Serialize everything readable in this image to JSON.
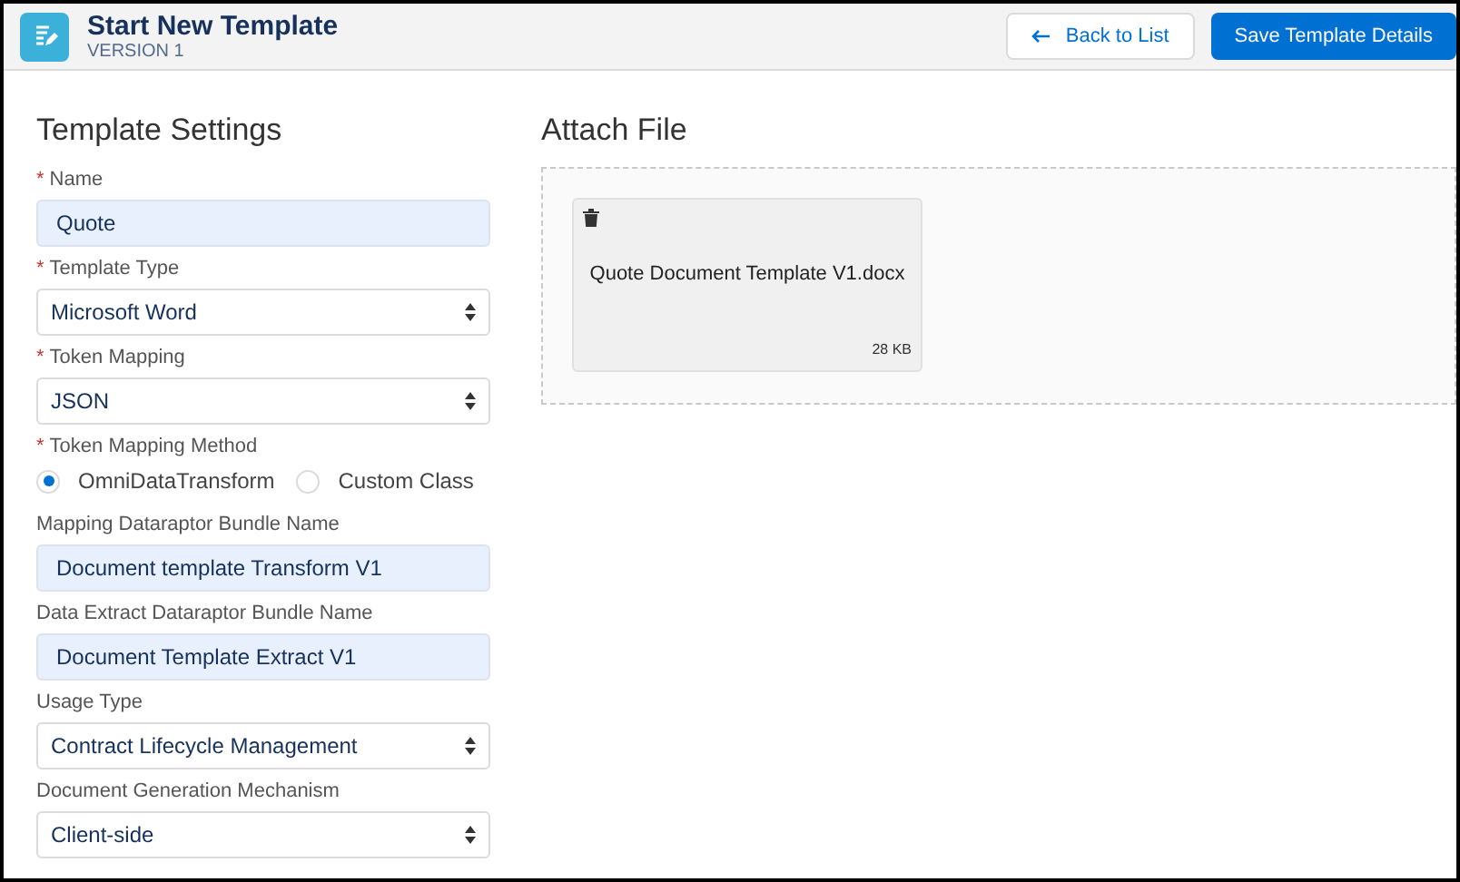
{
  "header": {
    "title": "Start New Template",
    "subtitle": "VERSION 1",
    "buttons": [
      {
        "label": "Back to List",
        "kind": "neutral"
      },
      {
        "label": "Save Template Details",
        "kind": "brand"
      }
    ]
  },
  "settings": {
    "title": "Template Settings",
    "fields": [
      {
        "kind": "input",
        "marker": "*",
        "label": "Name",
        "value": "Quote"
      },
      {
        "kind": "select",
        "marker": "*",
        "label": "Template Type",
        "value": "Microsoft Word"
      },
      {
        "kind": "select",
        "marker": "*",
        "label": "Token Mapping",
        "value": "JSON"
      },
      {
        "kind": "radio",
        "marker": "*",
        "label": "Token Mapping Method",
        "options": [
          {
            "label": "OmniDataTransform",
            "selected": true
          },
          {
            "label": "Custom Class",
            "selected": false
          }
        ]
      },
      {
        "kind": "input",
        "label": "Mapping Dataraptor Bundle Name",
        "value": "Document template Transform V1"
      },
      {
        "kind": "input",
        "label": "Data Extract Dataraptor Bundle Name",
        "value": "Document Template Extract V1"
      },
      {
        "kind": "select",
        "label": "Usage Type",
        "value": "Contract Lifecycle Management"
      },
      {
        "kind": "select",
        "label": "Document Generation Mechanism",
        "value": "Client-side"
      }
    ]
  },
  "attach": {
    "title": "Attach File",
    "files": [
      {
        "name": "Quote Document Template V1.docx",
        "size": "28 KB"
      }
    ]
  }
}
